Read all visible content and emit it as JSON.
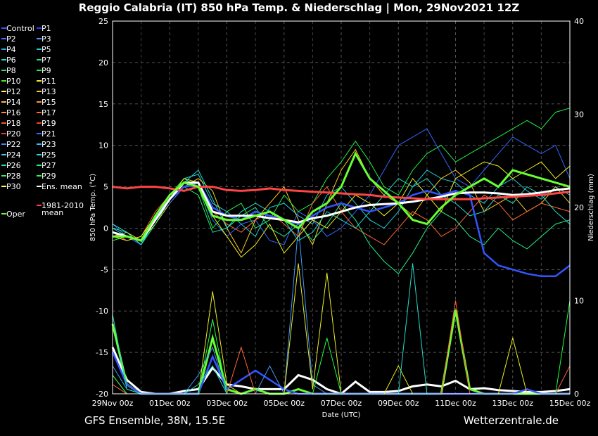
{
  "header": {
    "title": "Reggio Calabria  (IT)  850 hPa Temp. & Niederschlag | Mon, 29Nov2021 12Z"
  },
  "footer": {
    "left": "GFS Ensemble, 38N, 15.5E",
    "right": "Wetterzentrale.de"
  },
  "chart_data": {
    "type": "line",
    "title": "Reggio Calabria  (IT)  850 hPa Temp. & Niederschlag | Mon, 29Nov2021 12Z",
    "xlabel": "Date (UTC)",
    "ylabel": "850 hPa Temp. (°C)",
    "y2label": "Niederschlag (mm)",
    "ylim": [
      -20,
      25
    ],
    "y2lim": [
      0,
      40
    ],
    "yticks": [
      -20,
      -15,
      -10,
      -5,
      0,
      5,
      10,
      15,
      20,
      25
    ],
    "y2ticks": [
      0,
      10,
      20,
      30,
      40
    ],
    "xticks": [
      "29Nov 00z",
      "01Dec 00z",
      "03Dec 00z",
      "05Dec 00z",
      "07Dec 00z",
      "09Dec 00z",
      "11Dec 00z",
      "13Dec 00z",
      "15Dec 00z"
    ],
    "grid": true,
    "legend_position": "left",
    "legend": [
      {
        "name": "Control",
        "color": "#3355ff"
      },
      {
        "name": "P1",
        "color": "#2244ee"
      },
      {
        "name": "P2",
        "color": "#3377ff"
      },
      {
        "name": "P3",
        "color": "#4499ff"
      },
      {
        "name": "P4",
        "color": "#33aadd"
      },
      {
        "name": "P5",
        "color": "#22ccdd"
      },
      {
        "name": "P6",
        "color": "#22ddbb"
      },
      {
        "name": "P7",
        "color": "#22dd88"
      },
      {
        "name": "P8",
        "color": "#33dd66"
      },
      {
        "name": "P9",
        "color": "#22ee44"
      },
      {
        "name": "P10",
        "color": "#44ee22"
      },
      {
        "name": "P11",
        "color": "#eeee22"
      },
      {
        "name": "P12",
        "color": "#ffee66"
      },
      {
        "name": "P13",
        "color": "#ffcc22"
      },
      {
        "name": "P14",
        "color": "#ffbb44"
      },
      {
        "name": "P15",
        "color": "#ff9922"
      },
      {
        "name": "P16",
        "color": "#ff8844"
      },
      {
        "name": "P17",
        "color": "#ff6633"
      },
      {
        "name": "P18",
        "color": "#ff5522"
      },
      {
        "name": "P19",
        "color": "#ee4422"
      },
      {
        "name": "P20",
        "color": "#ee3333"
      },
      {
        "name": "P21",
        "color": "#3366ff"
      },
      {
        "name": "P22",
        "color": "#3388ff"
      },
      {
        "name": "P23",
        "color": "#33bbff"
      },
      {
        "name": "P24",
        "color": "#44ccee"
      },
      {
        "name": "P25",
        "color": "#22ddcc"
      },
      {
        "name": "P26",
        "color": "#22ddaa"
      },
      {
        "name": "P27",
        "color": "#22ee88"
      },
      {
        "name": "P28",
        "color": "#33ee66"
      },
      {
        "name": "P29",
        "color": "#22ff44"
      },
      {
        "name": "P30",
        "color": "#ffff44"
      },
      {
        "name": "Ens. mean",
        "color": "#ffffff"
      },
      {
        "name": "1981-2010\nmean",
        "color": "#ff4444"
      },
      {
        "name": "Oper",
        "color": "#66ff33"
      }
    ],
    "x_days": [
      0,
      0.5,
      1,
      1.5,
      2,
      2.5,
      3,
      3.5,
      4,
      4.5,
      5,
      5.5,
      6,
      6.5,
      7,
      7.5,
      8,
      8.5,
      9,
      9.5,
      10,
      10.5,
      11,
      11.5,
      12,
      12.5,
      13,
      13.5,
      14,
      14.5,
      15,
      15.5,
      16
    ],
    "series": [
      {
        "name": "Ens. mean",
        "color": "#ffffff",
        "width": 3,
        "values": [
          -0.5,
          -1.0,
          -1.5,
          1.0,
          3.5,
          5.5,
          5.5,
          2.0,
          1.5,
          1.5,
          1.5,
          1.2,
          1.0,
          0.7,
          1.2,
          1.5,
          2.0,
          2.5,
          2.8,
          2.9,
          3.0,
          3.2,
          3.5,
          3.8,
          4.2,
          4.3,
          4.3,
          4.2,
          4.0,
          4.1,
          4.3,
          4.6,
          4.8
        ]
      },
      {
        "name": "1981-2010 mean",
        "color": "#ff4444",
        "width": 3,
        "values": [
          5.0,
          4.8,
          5.0,
          5.0,
          4.8,
          4.5,
          5.0,
          5.0,
          4.6,
          4.5,
          4.6,
          4.8,
          4.6,
          4.5,
          4.4,
          4.3,
          4.2,
          4.1,
          4.0,
          3.8,
          3.7,
          3.6,
          3.5,
          3.5,
          3.5,
          3.5,
          3.6,
          3.7,
          3.8,
          3.9,
          4.0,
          4.2,
          4.4
        ]
      },
      {
        "name": "Oper",
        "color": "#66ff33",
        "width": 3,
        "values": [
          -1.0,
          -1.0,
          -1.5,
          1.5,
          4.0,
          5.5,
          5.0,
          1.5,
          1.0,
          1.0,
          1.5,
          2.0,
          1.0,
          0.0,
          2.0,
          3.0,
          5.0,
          9.0,
          6.0,
          4.5,
          3.0,
          1.0,
          0.5,
          2.5,
          4.0,
          5.0,
          6.0,
          5.0,
          7.0,
          6.5,
          6.0,
          5.5,
          5.0
        ]
      },
      {
        "name": "Control",
        "color": "#3355ff",
        "width": 2.5,
        "values": [
          -0.5,
          -1.0,
          -1.5,
          1.2,
          3.5,
          5.0,
          5.5,
          2.5,
          1.5,
          1.0,
          2.0,
          1.5,
          1.0,
          0.5,
          1.5,
          2.5,
          3.0,
          2.5,
          2.0,
          2.5,
          3.0,
          4.0,
          4.5,
          4.0,
          4.5,
          4.0,
          -3.0,
          -4.5,
          -5.0,
          -5.5,
          -5.8,
          -5.8,
          -4.5
        ]
      },
      {
        "name": "P5",
        "color": "#22ccdd",
        "width": 1,
        "values": [
          0.0,
          -1.0,
          -2.0,
          1.5,
          4.0,
          6.0,
          6.5,
          3.0,
          2.0,
          0.5,
          -1.0,
          2.5,
          3.0,
          1.5,
          0.5,
          4.0,
          5.0,
          3.0,
          1.0,
          0.0,
          2.0,
          5.0,
          7.0,
          6.0,
          5.5,
          4.0,
          3.0,
          5.0,
          6.0,
          4.5,
          3.5,
          5.0,
          4.0
        ]
      },
      {
        "name": "P13",
        "color": "#ffcc22",
        "width": 1,
        "values": [
          -1.0,
          -0.5,
          -1.5,
          0.5,
          3.0,
          5.0,
          6.0,
          4.5,
          0.0,
          -3.0,
          1.0,
          3.0,
          5.0,
          1.0,
          -2.0,
          3.0,
          7.0,
          9.5,
          6.0,
          4.0,
          3.0,
          1.5,
          4.0,
          6.0,
          7.0,
          5.5,
          2.0,
          3.0,
          4.0,
          2.0,
          3.0,
          5.0,
          3.0
        ]
      },
      {
        "name": "P21",
        "color": "#3366ff",
        "width": 1,
        "values": [
          0.5,
          -1.0,
          -2.0,
          1.0,
          3.0,
          5.0,
          5.0,
          1.0,
          -1.0,
          0.5,
          1.0,
          -1.5,
          -2.0,
          2.0,
          1.0,
          -1.0,
          0.0,
          2.0,
          4.0,
          7.0,
          10.0,
          11.0,
          12.0,
          9.0,
          6.0,
          5.0,
          7.0,
          9.0,
          11.0,
          10.0,
          9.0,
          10.0,
          6.0
        ]
      },
      {
        "name": "P9",
        "color": "#22ee44",
        "width": 1,
        "values": [
          -1.5,
          -1.0,
          -1.5,
          1.0,
          4.0,
          6.0,
          5.0,
          0.0,
          2.0,
          3.0,
          0.0,
          1.0,
          4.0,
          2.0,
          3.0,
          6.0,
          8.0,
          10.5,
          8.0,
          5.0,
          4.0,
          7.0,
          9.0,
          10.0,
          8.0,
          9.0,
          10.0,
          11.0,
          12.0,
          13.0,
          12.0,
          14.0,
          14.5
        ]
      },
      {
        "name": "P17",
        "color": "#ff6633",
        "width": 1,
        "values": [
          -0.5,
          -1.5,
          -1.0,
          2.0,
          4.0,
          5.5,
          5.0,
          2.0,
          0.5,
          -0.5,
          1.0,
          2.0,
          0.5,
          -1.0,
          3.0,
          5.0,
          2.0,
          0.0,
          -1.0,
          -2.0,
          0.0,
          2.0,
          1.0,
          -1.0,
          0.0,
          2.0,
          4.0,
          3.0,
          1.0,
          2.0,
          3.0,
          2.5,
          2.0
        ]
      },
      {
        "name": "P27",
        "color": "#22ee88",
        "width": 1,
        "values": [
          0.0,
          -0.5,
          -2.0,
          0.5,
          3.5,
          5.0,
          4.0,
          -0.5,
          0.0,
          1.5,
          2.5,
          0.0,
          -1.0,
          0.5,
          -1.5,
          0.5,
          3.0,
          1.0,
          -2.0,
          -4.0,
          -5.5,
          -3.0,
          0.0,
          2.0,
          1.0,
          -1.0,
          -2.0,
          0.0,
          -1.5,
          -2.5,
          -1.0,
          0.5,
          1.0
        ]
      },
      {
        "name": "P11",
        "color": "#eeee22",
        "width": 1,
        "values": [
          -1.0,
          -1.5,
          -1.0,
          1.5,
          3.5,
          6.0,
          5.5,
          1.5,
          -1.0,
          -3.5,
          -2.0,
          0.5,
          -3.0,
          -1.0,
          1.0,
          0.0,
          2.0,
          4.0,
          3.0,
          1.5,
          3.0,
          6.0,
          4.0,
          2.0,
          6.0,
          7.0,
          8.0,
          7.5,
          6.0,
          7.0,
          8.0,
          6.0,
          7.5
        ]
      },
      {
        "name": "P25",
        "color": "#22ddcc",
        "width": 1,
        "values": [
          0.5,
          -0.5,
          -2.0,
          1.0,
          3.5,
          5.5,
          7.0,
          3.5,
          0.0,
          2.0,
          3.0,
          2.0,
          1.0,
          -1.5,
          -0.5,
          2.0,
          1.0,
          0.0,
          2.0,
          4.0,
          6.0,
          5.0,
          6.0,
          4.0,
          3.0,
          1.5,
          2.0,
          4.0,
          3.0,
          5.0,
          4.0,
          2.0,
          0.5
        ]
      }
    ],
    "precip_series": [
      {
        "name": "Ens. mean",
        "color": "#ffffff",
        "width": 3,
        "values": [
          5.0,
          1.5,
          0.2,
          0.0,
          0.0,
          0.3,
          0.5,
          2.8,
          1.0,
          0.8,
          0.5,
          0.5,
          0.5,
          2.0,
          1.5,
          0.5,
          0.0,
          1.3,
          0.2,
          0.2,
          0.3,
          0.8,
          1.0,
          0.8,
          1.4,
          0.5,
          0.6,
          0.4,
          0.3,
          0.2,
          0.2,
          0.3,
          0.5
        ]
      },
      {
        "name": "Oper",
        "color": "#66ff33",
        "width": 3,
        "values": [
          7.5,
          1.0,
          0.0,
          0.0,
          0.0,
          0.0,
          0.0,
          6.0,
          0.5,
          0.0,
          0.5,
          0.0,
          0.0,
          0.5,
          0.0,
          0.0,
          0.0,
          0.0,
          0.0,
          0.0,
          0.0,
          0.0,
          0.0,
          0.0,
          9.0,
          0.5,
          0.0,
          0.0,
          0.0,
          0.0,
          0.0,
          0.0,
          0.0
        ]
      },
      {
        "name": "Control",
        "color": "#3355ff",
        "width": 2.5,
        "values": [
          4.5,
          1.0,
          0.0,
          0.0,
          0.0,
          0.0,
          0.0,
          4.0,
          0.5,
          1.5,
          2.5,
          1.5,
          0.5,
          0.0,
          0.0,
          0.0,
          0.0,
          0.0,
          0.0,
          0.0,
          0.0,
          0.0,
          0.0,
          0.0,
          0.0,
          0.0,
          0.0,
          0.0,
          0.0,
          0.5,
          0.0,
          0.0,
          0.0
        ]
      },
      {
        "name": "P3",
        "color": "#4499ff",
        "width": 1,
        "values": [
          3.0,
          0.5,
          0.0,
          0.0,
          0.0,
          0.0,
          2.0,
          5.0,
          0.0,
          0.0,
          0.0,
          3.0,
          0.0,
          18.0,
          1.0,
          0.0,
          0.0,
          0.0,
          0.0,
          0.0,
          0.0,
          0.0,
          0.0,
          0.0,
          0.0,
          0.0,
          0.0,
          0.0,
          0.0,
          0.0,
          0.0,
          0.0,
          0.0
        ]
      },
      {
        "name": "P11",
        "color": "#eeee22",
        "width": 1,
        "values": [
          2.0,
          0.0,
          0.0,
          0.0,
          0.0,
          0.0,
          0.0,
          11.0,
          1.0,
          0.0,
          0.0,
          0.0,
          0.0,
          14.0,
          0.5,
          13.0,
          0.0,
          0.0,
          0.0,
          0.0,
          3.0,
          0.0,
          0.0,
          0.0,
          0.0,
          0.0,
          0.0,
          0.0,
          6.0,
          0.0,
          0.0,
          0.0,
          0.0
        ]
      },
      {
        "name": "P25",
        "color": "#22ddcc",
        "width": 1,
        "values": [
          8.5,
          0.5,
          0.0,
          0.0,
          0.0,
          0.0,
          1.0,
          3.0,
          0.0,
          0.0,
          0.0,
          0.0,
          0.0,
          0.0,
          0.0,
          0.0,
          0.0,
          0.0,
          0.0,
          0.0,
          0.0,
          14.0,
          0.0,
          0.0,
          0.0,
          0.0,
          0.0,
          0.0,
          0.0,
          0.0,
          0.0,
          0.0,
          0.0
        ]
      },
      {
        "name": "P17",
        "color": "#ff6633",
        "width": 1,
        "values": [
          1.0,
          0.0,
          0.0,
          0.0,
          0.0,
          0.0,
          0.0,
          0.0,
          0.0,
          5.0,
          0.0,
          0.0,
          0.0,
          0.0,
          0.0,
          0.0,
          0.0,
          0.0,
          0.0,
          0.0,
          0.0,
          0.0,
          0.0,
          0.0,
          10.0,
          0.0,
          0.0,
          0.0,
          0.0,
          0.0,
          0.0,
          0.0,
          3.0
        ]
      },
      {
        "name": "P29",
        "color": "#22ff44",
        "width": 1,
        "values": [
          2.0,
          0.0,
          0.0,
          0.0,
          0.0,
          0.0,
          0.0,
          8.0,
          0.0,
          0.0,
          0.0,
          0.0,
          0.0,
          0.0,
          0.0,
          6.0,
          0.0,
          0.0,
          0.0,
          0.0,
          0.0,
          0.0,
          0.0,
          0.0,
          0.0,
          0.0,
          0.0,
          0.0,
          0.0,
          0.0,
          0.0,
          0.0,
          10.0
        ]
      }
    ]
  }
}
